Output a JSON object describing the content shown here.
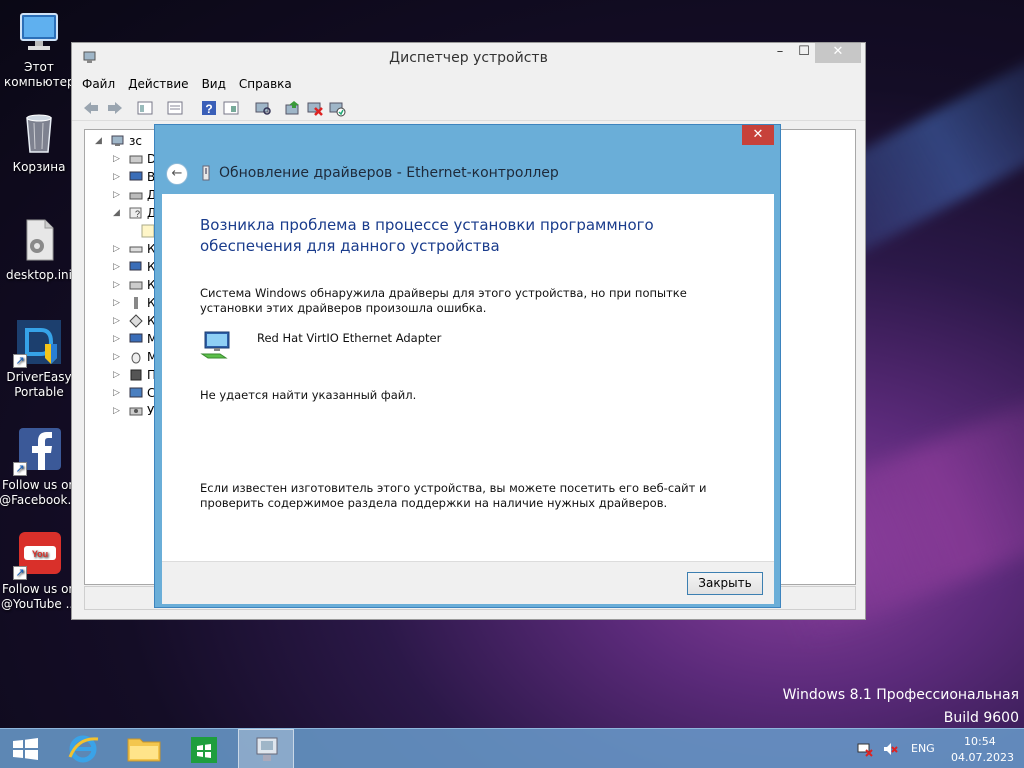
{
  "desktop": {
    "icons": [
      {
        "label": "Этот компьютер",
        "icon": "computer-icon"
      },
      {
        "label": "Корзина",
        "icon": "recycle-bin-icon"
      },
      {
        "label": "desktop.ini",
        "icon": "settings-file-icon"
      },
      {
        "label": "DriverEasy Portable",
        "icon": "drivereasy-icon"
      },
      {
        "label": "Follow us on @Facebook...",
        "icon": "facebook-icon"
      },
      {
        "label": "Follow us on @YouTube ...",
        "icon": "youtube-icon"
      }
    ],
    "watermark_line1": "Windows 8.1 Профессиональная",
    "watermark_line2": "Build 9600"
  },
  "device_manager": {
    "title": "Диспетчер устройств",
    "menu": [
      "Файл",
      "Действие",
      "Вид",
      "Справка"
    ],
    "tree_root": "зс",
    "tree_items": [
      "D",
      "В",
      "Д",
      "Д",
      "",
      "К",
      "К",
      "К",
      "К",
      "К",
      "М",
      "М",
      "П",
      "С",
      "У"
    ]
  },
  "dialog": {
    "title": "Обновление драйверов - Ethernet-контроллер",
    "heading": "Возникла проблема в процессе установки программного обеспечения для данного устройства",
    "description": "Система Windows обнаружила драйверы для этого устройства, но при попытке установки этих драйверов произошла ошибка.",
    "device_name": "Red Hat VirtIO Ethernet Adapter",
    "error": "Не удается найти указанный файл.",
    "advice": "Если известен изготовитель этого устройства, вы можете посетить его веб-сайт и проверить содержимое раздела поддержки на наличие нужных драйверов.",
    "close_button": "Закрыть"
  },
  "taskbar": {
    "language": "ENG",
    "time": "10:54",
    "date": "04.07.2023"
  },
  "colors": {
    "dialog_accent": "#6aaed8",
    "heading": "#1a3c8c",
    "close_red": "#c7413a",
    "taskbar": "#6898c8"
  }
}
